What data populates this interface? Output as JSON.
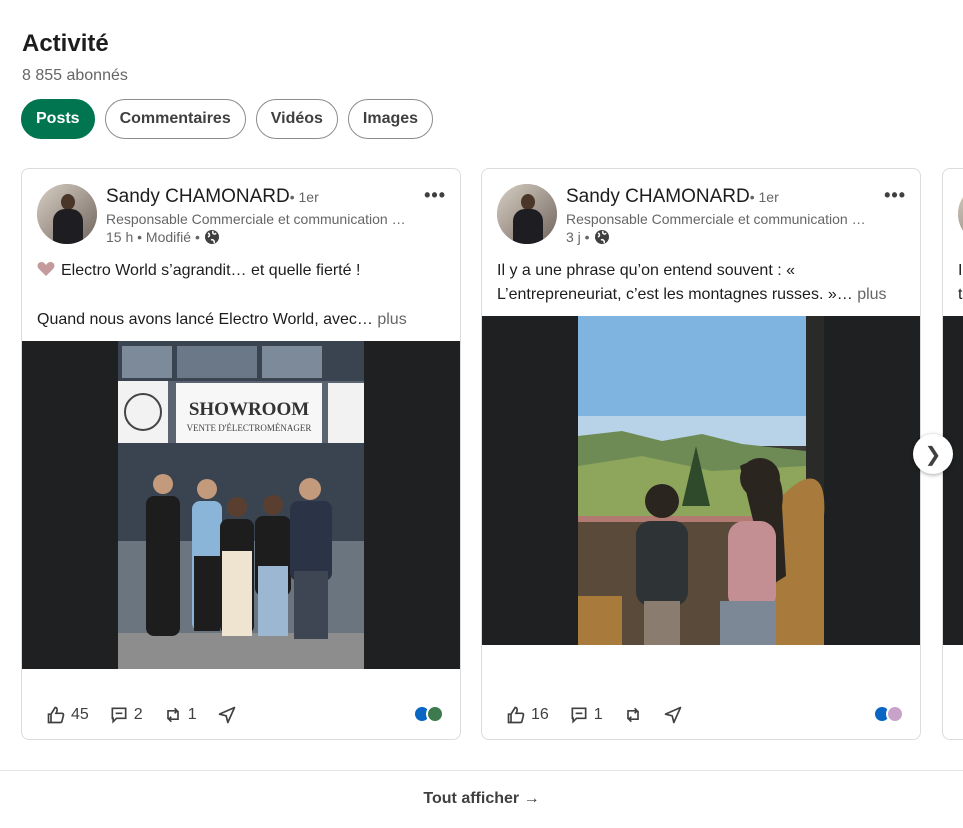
{
  "section": {
    "title": "Activité",
    "followers": "8 855 abonnés"
  },
  "filters": [
    {
      "label": "Posts",
      "active": true
    },
    {
      "label": "Commentaires",
      "active": false
    },
    {
      "label": "Vidéos",
      "active": false
    },
    {
      "label": "Images",
      "active": false
    }
  ],
  "posts": [
    {
      "author": "Sandy CHAMONARD",
      "degree": "• 1er",
      "headline": "Responsable Commerciale et communication chez Electro World",
      "meta": "15 h • Modifié •",
      "line1": "Electro World s’agrandit… et quelle fierté !",
      "line2": "Quand nous avons lancé Electro World, avec…",
      "more": "plus",
      "image": {
        "sign_title": "SHOWROOM",
        "sign_subtitle": "VENTE D'ÉLECTROMÉNAGER"
      },
      "reactions": "45",
      "comments": "2",
      "reposts": "1"
    },
    {
      "author": "Sandy CHAMONARD",
      "degree": "• 1er",
      "headline": "Responsable Commerciale et communication chez Electro World",
      "meta": "3 j •",
      "line1": "Il y a une phrase qu’on entend souvent : «",
      "line2": "L’entrepreneuriat, c’est les montagnes russes. »…",
      "more": "plus",
      "reactions": "16",
      "comments": "1",
      "reposts": ""
    }
  ],
  "peek": {
    "line1": "I",
    "line2": "t"
  },
  "navigation": {
    "next_arrow": "❯"
  },
  "footer": {
    "show_all": "Tout afficher",
    "arrow": "→"
  },
  "colors": {
    "accent": "#01754f",
    "text": "#1d1d1d",
    "muted": "#666666"
  },
  "icons": [
    "globe-icon",
    "heart-icon",
    "like-icon",
    "comment-icon",
    "repost-icon",
    "send-icon",
    "more-icon",
    "arrow-right-icon",
    "chevron-right-icon"
  ]
}
